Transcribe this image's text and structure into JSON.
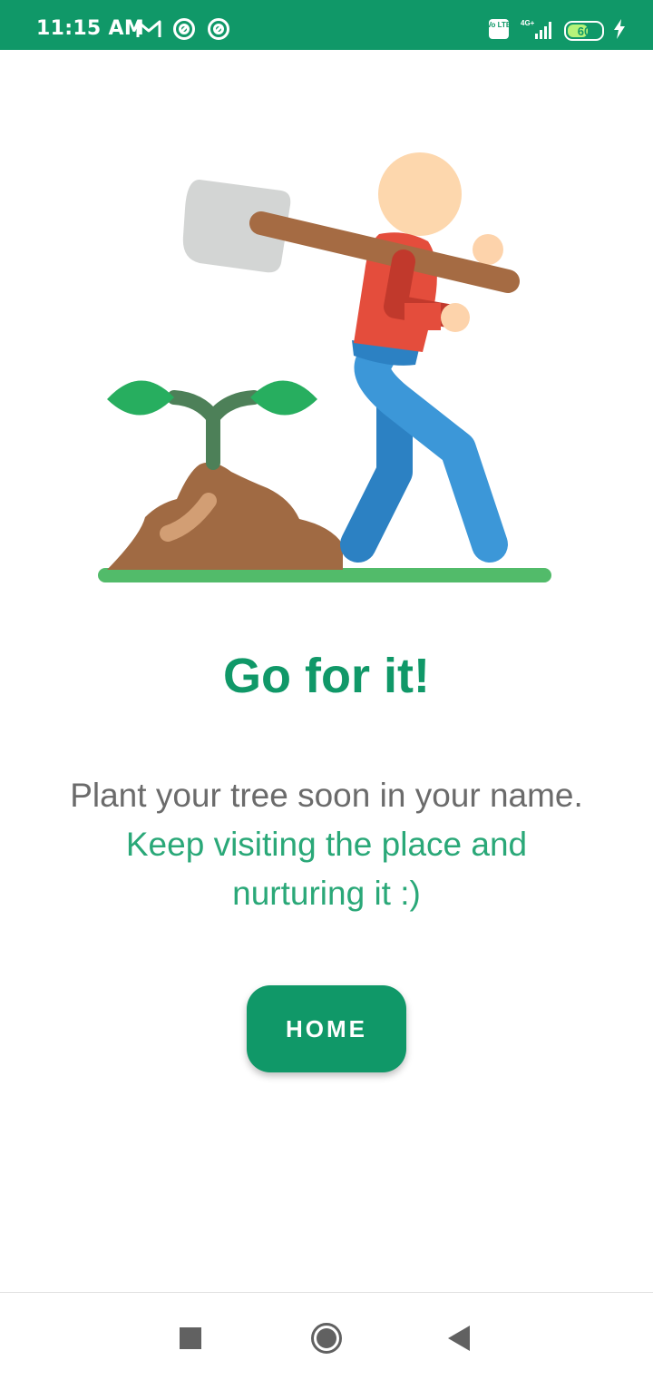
{
  "status_bar": {
    "time": "11:15 AM",
    "left_icons": [
      "gmail-icon",
      "sync-icon",
      "sync-icon"
    ],
    "network_label": "4G+",
    "volte_label": "Vo LTE",
    "battery_level": "60",
    "battery_percent": 60,
    "charging": true
  },
  "illustration": {
    "name": "person-with-shovel-and-sapling"
  },
  "content": {
    "title": "Go for it!",
    "message_line": "Plant your tree soon in your name.",
    "message_highlight": "Keep visiting the place and nurturing it :)"
  },
  "actions": {
    "home_label": "HOME"
  },
  "nav_bar": {
    "items": [
      "recents-icon",
      "home-icon",
      "back-icon"
    ]
  },
  "colors": {
    "primary": "#109868",
    "accent_text": "#2aa878",
    "body_text": "#6b6b6b"
  }
}
